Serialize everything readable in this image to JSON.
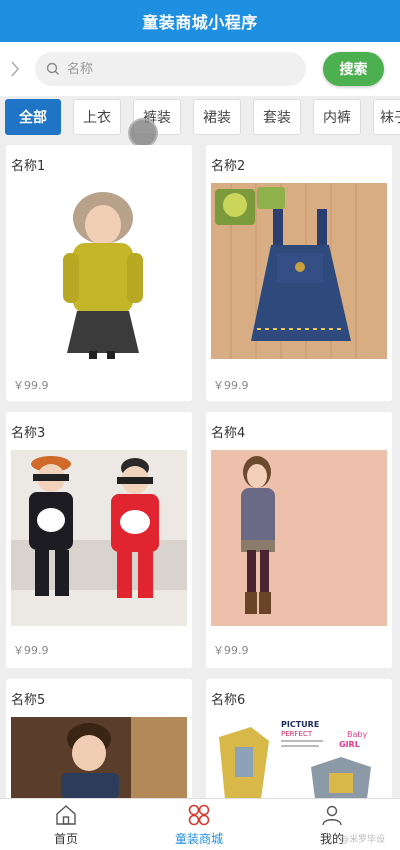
{
  "app_title": "童装商城小程序",
  "search": {
    "placeholder": "名称",
    "button_label": "搜索"
  },
  "tabs": [
    "全部",
    "上衣",
    "裤装",
    "裙装",
    "套装",
    "内裤",
    "袜子"
  ],
  "products": [
    {
      "name": "名称1",
      "price": "￥99.9"
    },
    {
      "name": "名称2",
      "price": "￥99.9"
    },
    {
      "name": "名称3",
      "price": "￥99.9"
    },
    {
      "name": "名称4",
      "price": "￥99.9"
    },
    {
      "name": "名称5",
      "price": ""
    },
    {
      "name": "名称6",
      "price": ""
    }
  ],
  "bottom_nav": [
    {
      "label": "首页",
      "icon": "home-icon"
    },
    {
      "label": "童装商城",
      "icon": "mall-icon",
      "active": true
    },
    {
      "label": "我的",
      "icon": "user-icon"
    }
  ],
  "watermark": "@米罗毕设",
  "colors": {
    "primary": "#1e8fe1",
    "search_button": "#4caf50",
    "active_tab": "#1f74c5"
  }
}
